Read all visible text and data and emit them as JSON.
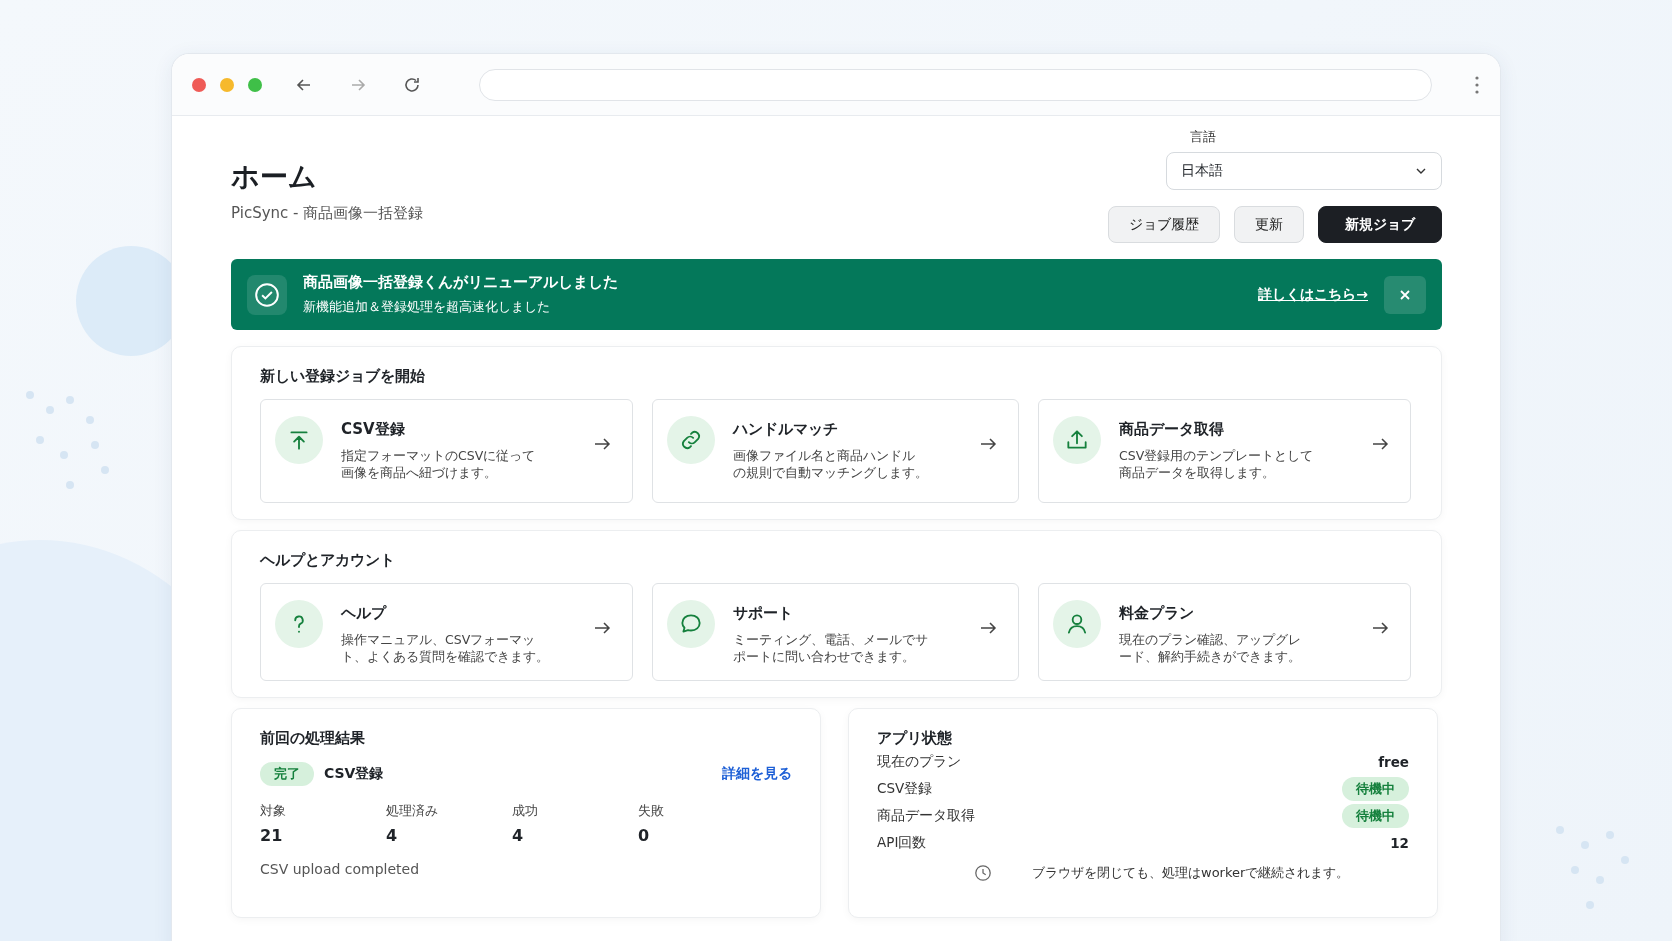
{
  "header": {
    "title": "ホーム",
    "subtitle": "PicSync - 商品画像一括登録",
    "language": {
      "label": "言語",
      "value": "日本語"
    },
    "buttons": [
      {
        "label": "ジョブ履歴",
        "kind": "secondary"
      },
      {
        "label": "更新",
        "kind": "secondary"
      },
      {
        "label": "新規ジョブ",
        "kind": "primary"
      }
    ]
  },
  "banner": {
    "title": "商品画像一括登録くんがリニューアルしました",
    "message": "新機能追加＆登録処理を超高速化しました",
    "link": "詳しくはこちら→"
  },
  "sections": [
    {
      "title": "新しい登録ジョブを開始",
      "tiles": [
        {
          "title": "CSV登録",
          "description_lines": [
            "指定フォーマットのCSVに従って",
            "画像を商品へ紐づけます。"
          ]
        },
        {
          "title": "ハンドルマッチ",
          "description_lines": [
            "画像ファイル名と商品ハンドル",
            "の規則で自動マッチングします。"
          ]
        },
        {
          "title": "商品データ取得",
          "description_lines": [
            "CSV登録用のテンプレートとして",
            "商品データを取得します。"
          ]
        }
      ]
    },
    {
      "title": "ヘルプとアカウント",
      "tiles": [
        {
          "title": "ヘルプ",
          "description_lines": [
            "操作マニュアル、CSVフォーマッ",
            "ト、よくある質問を確認できます。"
          ]
        },
        {
          "title": "サポート",
          "description_lines": [
            "ミーティング、電話、メールでサ",
            "ポートに問い合わせできます。"
          ]
        },
        {
          "title": "料金プラン",
          "description_lines": [
            "現在のプラン確認、アップグレ",
            "ード、解約手続きができます。"
          ]
        }
      ]
    }
  ],
  "last_result": {
    "title": "前回の処理結果",
    "status": {
      "label": "完了",
      "kind": "success"
    },
    "job": "CSV登録",
    "link": "詳細を見る",
    "stats": [
      {
        "label": "対象",
        "value": "21"
      },
      {
        "label": "処理済み",
        "value": "4"
      },
      {
        "label": "成功",
        "value": "4"
      },
      {
        "label": "失敗",
        "value": "0"
      }
    ],
    "message": "CSV upload completed"
  },
  "app_status": {
    "title": "アプリ状態",
    "rows": [
      {
        "label": "現在のプラン",
        "value": "free",
        "kind": "text"
      },
      {
        "label": "CSV登録",
        "value": "待機中",
        "kind": "badge"
      },
      {
        "label": "商品データ取得",
        "value": "待機中",
        "kind": "badge"
      },
      {
        "label": "API回数",
        "value": "12",
        "kind": "text"
      }
    ],
    "note": "ブラウザを閉じても、処理はworkerで継続されます。"
  }
}
